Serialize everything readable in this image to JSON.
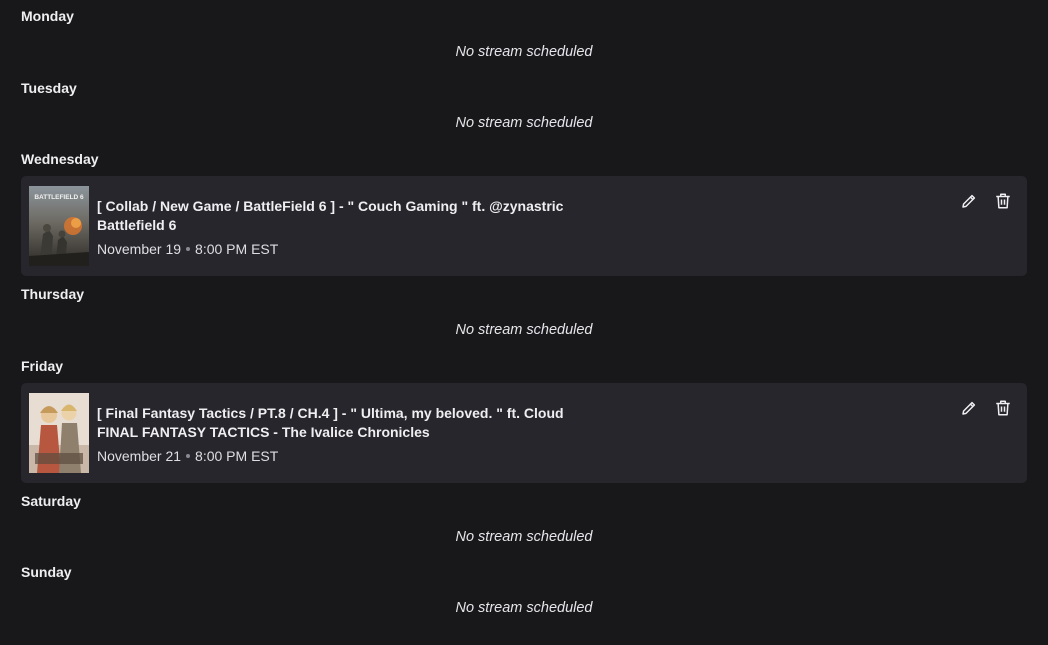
{
  "days": [
    {
      "label": "Monday",
      "empty_text": "No stream scheduled"
    },
    {
      "label": "Tuesday",
      "empty_text": "No stream scheduled"
    },
    {
      "label": "Wednesday"
    },
    {
      "label": "Thursday",
      "empty_text": "No stream scheduled"
    },
    {
      "label": "Friday"
    },
    {
      "label": "Saturday",
      "empty_text": "No stream scheduled"
    },
    {
      "label": "Sunday",
      "empty_text": "No stream scheduled"
    }
  ],
  "segments": [
    {
      "title": "[ Collab / New Game / BattleField 6 ] - \" Couch Gaming \" ft. @zynastric",
      "game": "Battlefield 6",
      "date": "November 19",
      "time": "8:00 PM EST",
      "thumb_text": "BATTLEFIELD 6",
      "edit_icon": "pencil-icon",
      "delete_icon": "trash-icon"
    },
    {
      "title": "[ Final Fantasy Tactics / PT.8 / CH.4 ] - \" Ultima, my beloved. \" ft. Cloud",
      "game": "FINAL FANTASY TACTICS - The Ivalice Chronicles",
      "date": "November 21",
      "time": "8:00 PM EST",
      "edit_icon": "pencil-icon",
      "delete_icon": "trash-icon"
    }
  ],
  "colors": {
    "background": "#18181b",
    "card": "#26262c",
    "text": "#efeff1"
  }
}
